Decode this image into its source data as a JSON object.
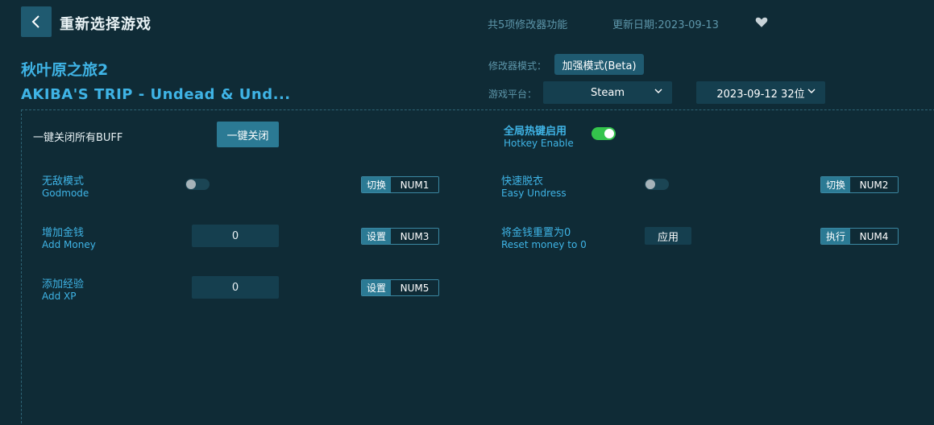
{
  "header": {
    "back_label": "重新选择游戏",
    "feature_count": "共5项修改器功能",
    "update_date": "更新日期:2023-09-13"
  },
  "game": {
    "title_cn": "秋叶原之旅2",
    "title_en": "AKIBA'S TRIP - Undead & Und..."
  },
  "settings": {
    "mode_label": "修改器模式：",
    "mode_value": "加强模式(Beta)",
    "platform_label": "游戏平台：",
    "platform_value": "Steam",
    "version_value": "2023-09-12 32位"
  },
  "controls": {
    "close_all_label": "一键关闭所有BUFF",
    "close_all_button": "一键关闭",
    "hotkey_cn": "全局热键启用",
    "hotkey_en": "Hotkey Enable",
    "hotkey_enabled": true
  },
  "features": [
    {
      "name_cn": "无敌模式",
      "name_en": "Godmode",
      "action": "切换",
      "key": "NUM1",
      "enabled": false
    },
    {
      "name_cn": "快速脱衣",
      "name_en": "Easy Undress",
      "action": "切换",
      "key": "NUM2",
      "enabled": false
    },
    {
      "name_cn": "增加金钱",
      "name_en": "Add Money",
      "action": "设置",
      "key": "NUM3",
      "value": "0"
    },
    {
      "name_cn": "将金钱重置为0",
      "name_en": "Reset money to 0",
      "action": "执行",
      "key": "NUM4",
      "button": "应用"
    },
    {
      "name_cn": "添加经验",
      "name_en": "Add XP",
      "action": "设置",
      "key": "NUM5",
      "value": "0"
    }
  ],
  "icons": {
    "back": "chevron-left-icon",
    "favorite": "heart-icon",
    "dropdown": "chevron-down-icon"
  },
  "colors": {
    "background": "#0f2b36",
    "accent": "#3fb4e6",
    "button": "#2b7a94",
    "toggle_on": "#34c44c"
  }
}
